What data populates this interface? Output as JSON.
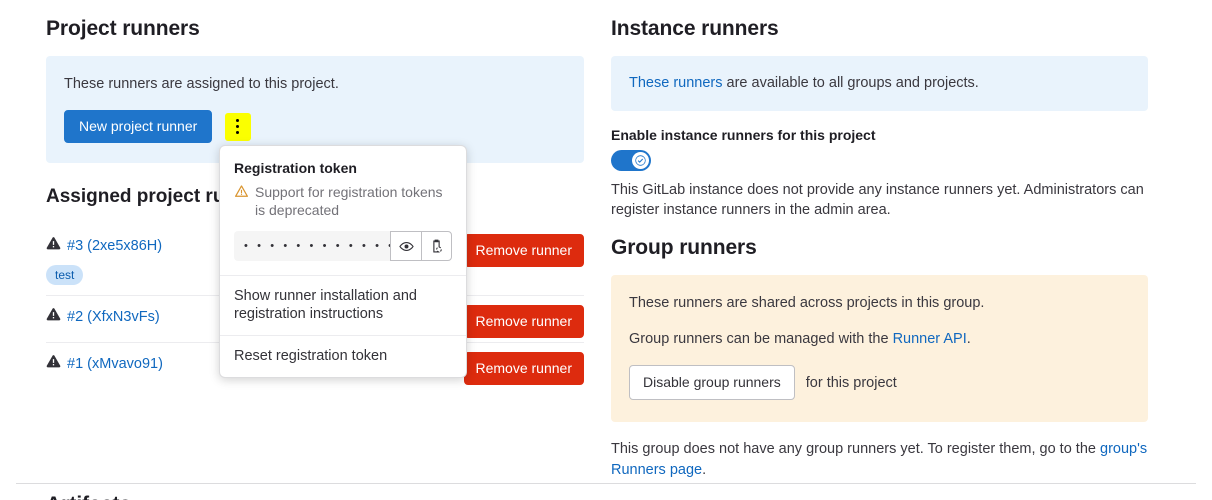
{
  "project_runners": {
    "title": "Project runners",
    "info_text": "These runners are assigned to this project.",
    "new_runner_button": "New project runner",
    "kebab_icon": "ellipsis-vertical-icon"
  },
  "dropdown": {
    "title": "Registration token",
    "warning_icon": "warning-triangle-icon",
    "warning_text": "Support for registration tokens is deprecated",
    "token_masked": "• • • • • • • • • • • • • •",
    "reveal_icon": "eye-icon",
    "copy_icon": "clipboard-icon",
    "item_show_instructions": "Show runner installation and registration instructions",
    "item_reset_token": "Reset registration token"
  },
  "assigned_runners": {
    "title": "Assigned project runners",
    "remove_button_label": "Remove runner",
    "edit_icon": "pencil-icon",
    "pause_icon": "pause-icon",
    "status_icon": "warning-triangle-icon",
    "rows": [
      {
        "id": "#3 (2xe5x86H)",
        "tag": "test",
        "has_edit_actions": false
      },
      {
        "id": "#2 (XfxN3vFs)",
        "tag": "",
        "has_edit_actions": false
      },
      {
        "id": "#1 (xMvavo91)",
        "tag": "",
        "has_edit_actions": true
      }
    ]
  },
  "instance_runners": {
    "title": "Instance runners",
    "info_link": "These runners",
    "info_rest": " are available to all groups and projects.",
    "toggle_label": "Enable instance runners for this project",
    "toggle_state": "on",
    "toggle_check_icon": "check-icon",
    "helper_text": "This GitLab instance does not provide any instance runners yet. Administrators can register instance runners in the admin area."
  },
  "group_runners": {
    "title": "Group runners",
    "line1": "These runners are shared across projects in this group.",
    "line2_prefix": "Group runners can be managed with the ",
    "line2_link": "Runner API",
    "line2_suffix": ".",
    "disable_button": "Disable group runners",
    "disable_after_text": "for this project",
    "footer_text": "This group does not have any group runners yet. To register them, go to the ",
    "footer_link": "group's Runners page",
    "footer_suffix": "."
  },
  "bottom": {
    "next_section_title": "Artifacts"
  },
  "colors": {
    "primary": "#1f75cb",
    "danger": "#dd2b0e",
    "link": "#1068bf",
    "info_bg": "#e9f3fc",
    "warning_bg": "#fdf1dd",
    "highlight": "#fbff00"
  }
}
